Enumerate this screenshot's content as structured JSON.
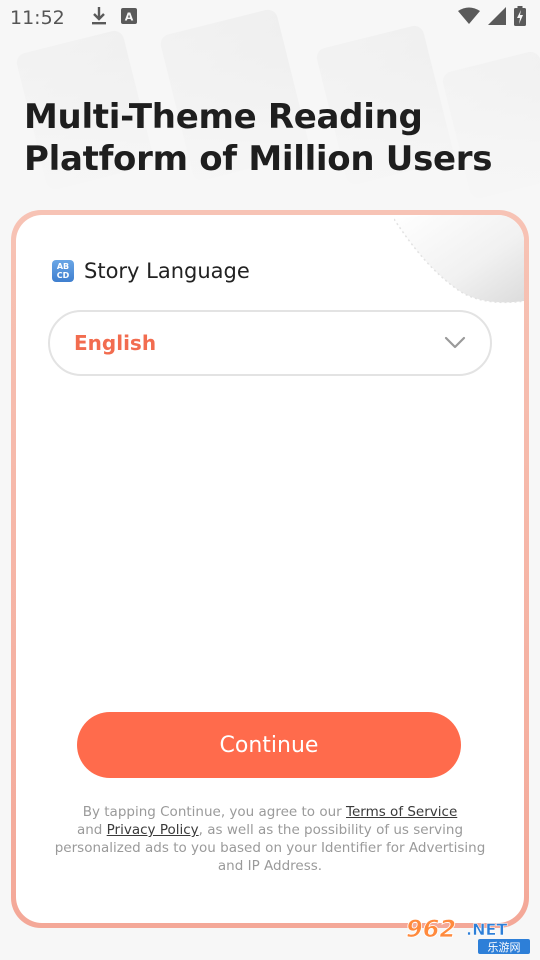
{
  "status_bar": {
    "time": "11:52",
    "icons_left": [
      "download-icon",
      "translate-a-icon"
    ],
    "icons_right": [
      "wifi-icon",
      "signal-icon",
      "battery-charging-icon"
    ]
  },
  "headline": {
    "line1": "Multi-Theme Reading",
    "line2": "Platform of Million Users"
  },
  "language_section": {
    "icon": "abcd-input-icon",
    "icon_text_top": "AB",
    "icon_text_bottom": "CD",
    "title": "Story Language",
    "selected_language": "English"
  },
  "continue_button": {
    "label": "Continue"
  },
  "legal": {
    "text_before_terms": "By tapping Continue, you agree to our ",
    "terms_link": "Terms of Service",
    "text_and": "and ",
    "privacy_link": "Privacy Policy",
    "text_after_privacy": ", as well as the possibility of us serving personalized ads to you based on your Identifier for Advertising and IP Address."
  },
  "watermark": {
    "brand": "962.NET",
    "subtitle": "乐游网"
  },
  "colors": {
    "accent": "#ff6b4c",
    "selected_text": "#f26c4f",
    "card_border": "#f4a898",
    "legal_text": "#9a9a9a"
  }
}
